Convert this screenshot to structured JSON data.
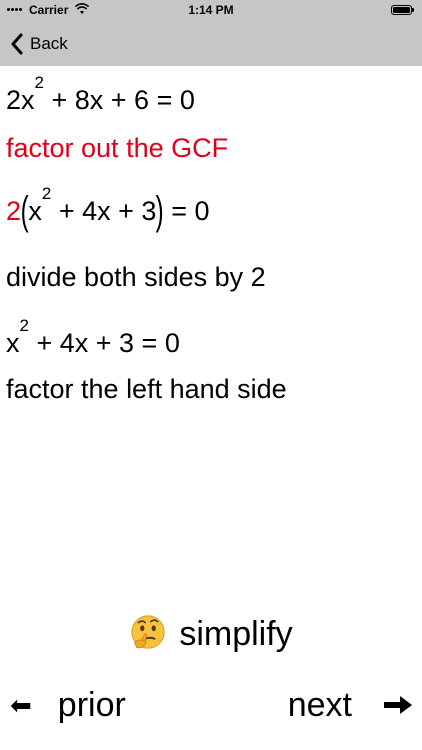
{
  "status_bar": {
    "carrier": "Carrier",
    "time": "1:14 PM"
  },
  "nav": {
    "back_label": "Back"
  },
  "steps": [
    {
      "kind": "math",
      "pieces": [
        "2x",
        "2",
        " + 8x + 6 = 0"
      ]
    },
    {
      "kind": "text",
      "text": "factor out the GCF",
      "color": "#e0001a"
    },
    {
      "kind": "math",
      "pieces": [
        "2",
        "(",
        "x",
        "2",
        " + 4x + 3",
        ")",
        " = 0"
      ]
    },
    {
      "kind": "text",
      "text": "divide both sides by 2"
    },
    {
      "kind": "math",
      "pieces": [
        "x",
        "2",
        " + 4x + 3 = 0"
      ]
    },
    {
      "kind": "text",
      "text": "factor the left hand side"
    }
  ],
  "actions": {
    "simplify_label": "simplify",
    "prior_label": "prior",
    "next_label": "next",
    "prior_arrow": "⬅",
    "simplify_icon": "thinking-face-icon"
  },
  "colors": {
    "accent_red": "#e0001a",
    "nav_gray": "#c6c6c6"
  }
}
